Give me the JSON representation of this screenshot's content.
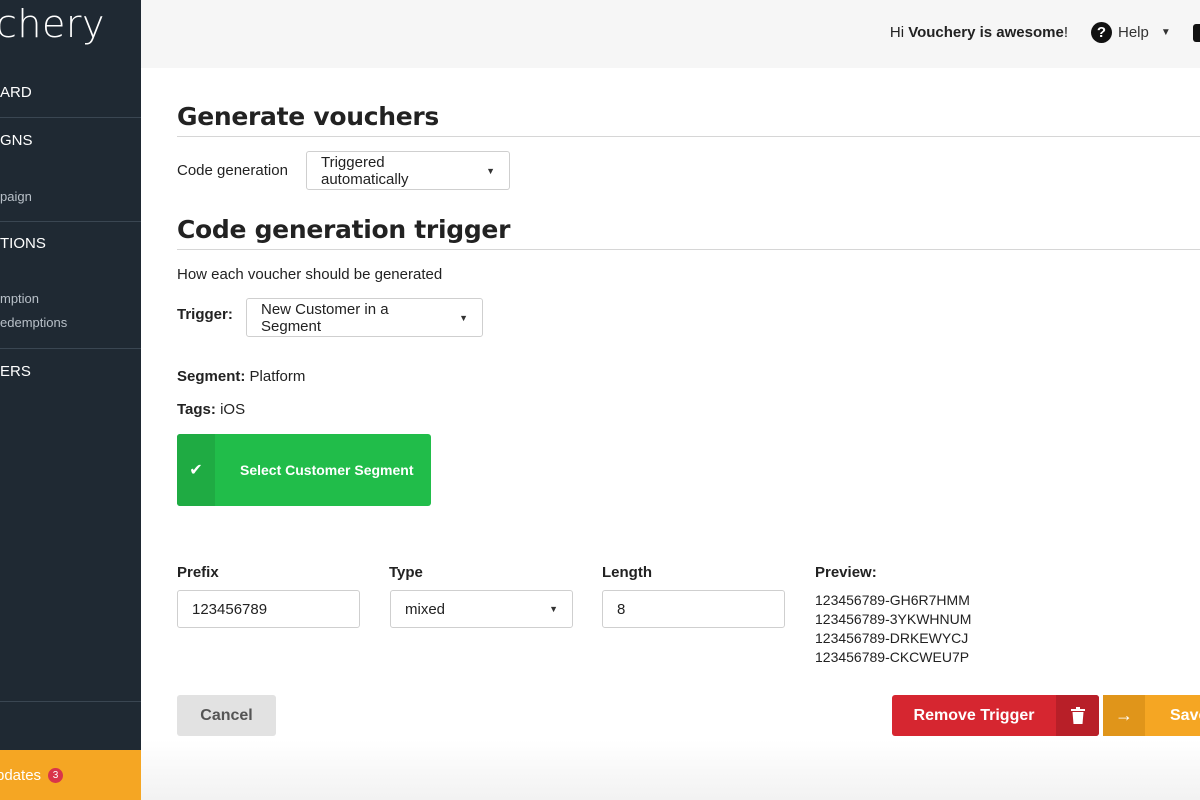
{
  "sidebar": {
    "logo": "chery",
    "items": [
      {
        "label": "ARD"
      },
      {
        "label": "GNS"
      },
      {
        "label": "paign"
      },
      {
        "label": "TIONS"
      },
      {
        "label": "mption"
      },
      {
        "label": "edemptions"
      },
      {
        "label": "ERS"
      }
    ],
    "updates_label": "pdates",
    "updates_count": "3"
  },
  "header": {
    "greeting_prefix": "Hi",
    "greeting_name": "Vouchery is awesome",
    "greeting_suffix": "!",
    "help_label": "Help"
  },
  "main": {
    "generate_title": "Generate vouchers",
    "code_generation_label": "Code generation",
    "code_generation_value": "Triggered automatically",
    "trigger_title": "Code generation trigger",
    "trigger_description": "How each voucher should be generated",
    "trigger_label": "Trigger:",
    "trigger_value": "New Customer in a Segment",
    "segment_label": "Segment:",
    "segment_value": "Platform",
    "tags_label": "Tags:",
    "tags_value": "iOS",
    "select_segment_button": "Select Customer Segment",
    "prefix_label": "Prefix",
    "prefix_value": "123456789",
    "type_label": "Type",
    "type_value": "mixed",
    "length_label": "Length",
    "length_value": "8",
    "preview_label": "Preview:",
    "preview_codes": [
      "123456789-GH6R7HMM",
      "123456789-3YKWHNUM",
      "123456789-DRKEWYCJ",
      "123456789-CKCWEU7P"
    ],
    "cancel_button": "Cancel",
    "remove_trigger_button": "Remove Trigger",
    "save_button": "Save"
  },
  "colors": {
    "sidebar_bg": "#1f2933",
    "accent_orange": "#f5a623",
    "success_green": "#21bd4a",
    "danger_red": "#d62630"
  },
  "icons": [
    "help-icon",
    "chevron-down-icon",
    "check-icon",
    "trash-icon",
    "arrow-right-icon",
    "puzzle-icon"
  ]
}
